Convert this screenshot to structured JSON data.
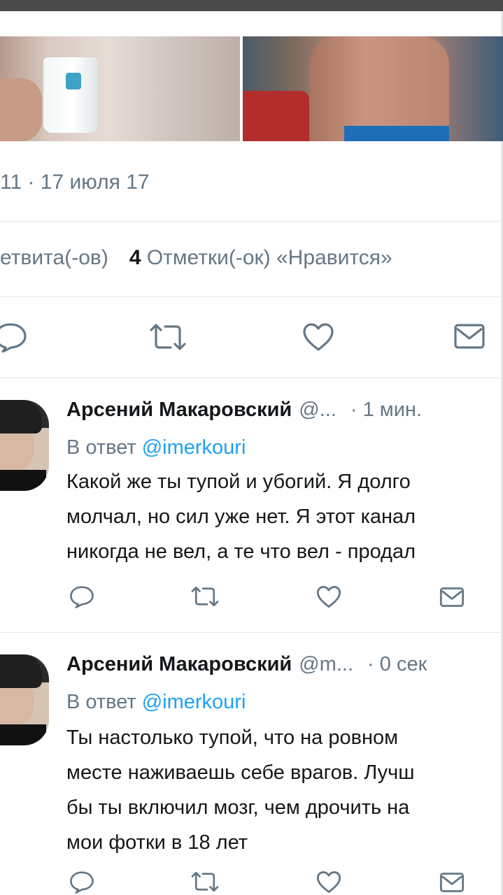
{
  "main_tweet": {
    "timestamp": "11 · 17 июля 17",
    "stats": {
      "retweets_label": "етвита(-ов)",
      "likes_count": "4",
      "likes_label": "Отметки(-ок) «Нравится»"
    },
    "actions": [
      "reply-icon",
      "retweet-icon",
      "like-icon",
      "message-icon"
    ]
  },
  "replies": [
    {
      "author_name": "Арсений Макаровский",
      "handle": "@...",
      "time": "· 1 мин.",
      "reply_prefix": "В ответ",
      "reply_to": "@imerkouri",
      "text_lines": [
        "Какой же ты тупой и убогий. Я долго",
        "молчал, но сил уже нет. Я этот канал",
        "никогда не вел, а те что вел - продал"
      ]
    },
    {
      "author_name": "Арсений Макаровский",
      "handle": "@m...",
      "time": "· 0 сек",
      "reply_prefix": "В ответ",
      "reply_to": "@imerkouri",
      "text_lines": [
        "Ты настолько тупой, что на ровном",
        "месте наживаешь себе врагов. Лучш",
        "бы ты включил мозг, чем дрочить на",
        "мои фотки в 18 лет"
      ]
    }
  ],
  "colors": {
    "text": "#14171a",
    "secondary": "#657786",
    "link": "#1da1f2",
    "divider": "#e1e8ed"
  }
}
